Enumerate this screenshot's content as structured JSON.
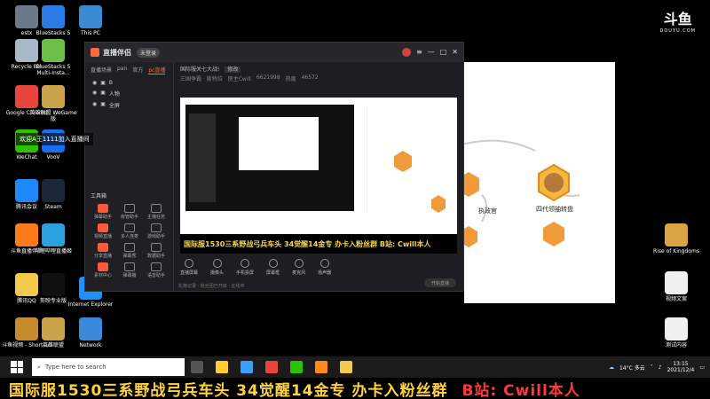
{
  "watermark": {
    "logo": "斗鱼",
    "sub": "DOUYU.COM"
  },
  "desktop_left": [
    {
      "label": "estx",
      "color": "#6a7a8a"
    },
    {
      "label": "BlueStacks 5",
      "color": "#2b7be4"
    },
    {
      "label": "This PC",
      "color": "#3b8bd4"
    },
    {
      "label": "Recycle Bin",
      "color": "#a8b8c8"
    },
    {
      "label": "BlueStacks 5 Multi-Insta...",
      "color": "#6cc04a"
    },
    {
      "label": "Google Chrome",
      "color": "#e8453c"
    },
    {
      "label": "英雄联盟 WeGame版",
      "color": "#c9a24a"
    },
    {
      "label": "WeChat",
      "color": "#2dc100"
    },
    {
      "label": "VooV",
      "color": "#1a6ff0"
    },
    {
      "label": "腾讯会议",
      "color": "#1e88ff"
    },
    {
      "label": "Steam",
      "color": "#1b2838"
    },
    {
      "label": "斗鱼直播伴侣",
      "color": "#ff7a1a"
    },
    {
      "label": "哔哩哔哩直播姬",
      "color": "#29a3e0"
    },
    {
      "label": "腾讯QQ",
      "color": "#f2c94c"
    },
    {
      "label": "剪映专业版",
      "color": "#111111"
    },
    {
      "label": "斗鱼视频 - Shortcut",
      "color": "#c78a2e"
    },
    {
      "label": "英雄联盟",
      "color": "#c9a24a"
    },
    {
      "label": "Internet Explorer",
      "color": "#1e90ff"
    },
    {
      "label": "Network",
      "color": "#3a8ad8"
    }
  ],
  "desktop_right": [
    {
      "label": "Rise of Kingdoms",
      "color": "#d9a441"
    },
    {
      "label": "视频文案",
      "color": "#f0f0f0"
    },
    {
      "label": "测试内容",
      "color": "#f0f0f0"
    }
  ],
  "join_message": "欢迎A王1111加入直播间",
  "app": {
    "title": "直播伴侣",
    "badge": "未登录",
    "sidebar_tabs": [
      "直播场景",
      "pan",
      "官方",
      "pc直播"
    ],
    "sources": [
      "B",
      "人物",
      "全屏"
    ],
    "tools_header": "工具箱",
    "tools": [
      "弹幕助手",
      "房管助手",
      "主播任务",
      "视频直播",
      "多人连麦",
      "游戏助手",
      "分享直播",
      "弹幕秀",
      "数据助手",
      "素材中心",
      "弹幕播",
      "语音助手"
    ],
    "room_title": "国际服关七大战!",
    "room_edit": "修改",
    "room_info": [
      "三国争霸 · 斯特拉",
      "房主Cwill",
      "6621998",
      "热度",
      "46572"
    ],
    "controls": [
      "直播屏幕",
      "摄像头",
      "手机投屏",
      "屏幕框",
      "麦克风",
      "扬声器"
    ],
    "start_label": "开始直播",
    "footer": "礼物记录 · 粉丝团已开启 · 在线中"
  },
  "preview_banner": "国际服1530三系野战弓兵车头  34觉醒14金专  办卡入粉丝群  B站: Cwill本人",
  "diagram": {
    "labels": [
      "执政官",
      "四代领袖转盘"
    ]
  },
  "taskbar": {
    "search_placeholder": "Type here to search",
    "apps": [
      "#555",
      "#ffcc33",
      "#3aa0ff",
      "#e8453c",
      "#2dc100",
      "#ff8a1a",
      "#f2c94c"
    ],
    "weather": "14°C 多云",
    "time": "13:15",
    "date": "2021/12/4"
  },
  "bottom_banner": "国际服1530三系野战弓兵车头    34觉醒14金专    办卡入粉丝群",
  "bottom_banner_red": "B站: Cwill本人"
}
